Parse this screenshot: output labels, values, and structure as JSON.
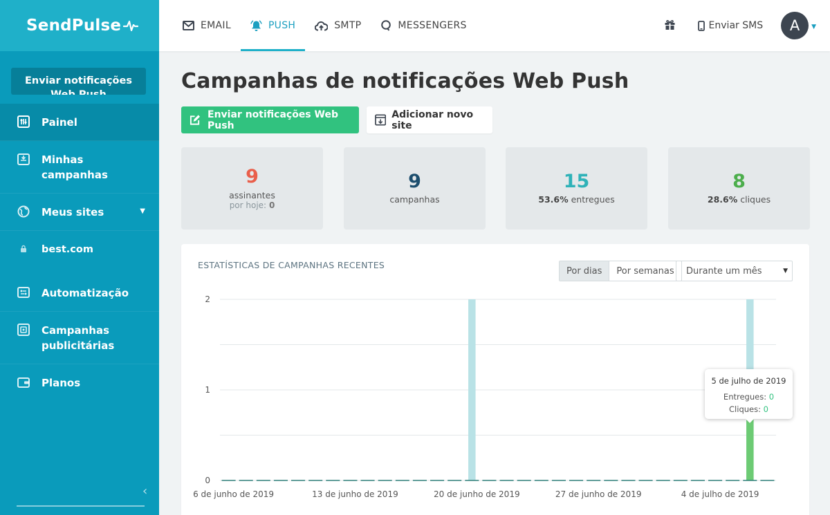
{
  "brand": {
    "name": "SendPulse"
  },
  "sidebar": {
    "send_button": "Enviar notificações Web Push",
    "items": [
      {
        "label": "Painel",
        "icon": "dashboard-icon"
      },
      {
        "label": "Minhas campanhas",
        "icon": "campaigns-icon"
      },
      {
        "label": "Meus sites",
        "icon": "globe-icon"
      },
      {
        "label": "best.com",
        "icon": "lock-icon"
      },
      {
        "label": "Automatização",
        "icon": "automation-icon"
      },
      {
        "label": "Campanhas publicitárias",
        "icon": "ads-icon"
      },
      {
        "label": "Planos",
        "icon": "wallet-icon"
      }
    ]
  },
  "topbar": {
    "tabs": [
      {
        "label": "EMAIL",
        "icon": "mail-icon"
      },
      {
        "label": "PUSH",
        "icon": "bell-icon"
      },
      {
        "label": "SMTP",
        "icon": "cloud-upload-icon"
      },
      {
        "label": "MESSENGERS",
        "icon": "chat-icon"
      }
    ],
    "sms_label": "Enviar SMS",
    "avatar_letter": "A"
  },
  "main": {
    "title": "Campanhas de notificações Web Push",
    "send_button": "Enviar notificações Web Push",
    "add_site_button": "Adicionar novo site"
  },
  "stats": {
    "subscribers": {
      "value": "9",
      "label": "assinantes",
      "today_label": "por hoje:",
      "today_value": "0",
      "color": "#e95e4a"
    },
    "campaigns": {
      "value": "9",
      "label": "campanhas",
      "color": "#1d4e6e"
    },
    "delivered": {
      "value": "15",
      "percent": "53.6%",
      "label": "entregues",
      "color": "#2fb2b8"
    },
    "clicks": {
      "value": "8",
      "percent": "28.6%",
      "label": "cliques",
      "color": "#4cae4c"
    }
  },
  "chart_section": {
    "title": "ESTATÍSTICAS DE CAMPANHAS RECENTES",
    "by_days": "Por dias",
    "by_weeks": "Por semanas",
    "period": "Durante um mês"
  },
  "tooltip": {
    "date": "5 de julho de 2019",
    "delivered_label": "Entregues:",
    "delivered_value": "0",
    "clicks_label": "Cliques:",
    "clicks_value": "0"
  },
  "chart_data": {
    "type": "bar",
    "ylim": [
      0,
      2
    ],
    "yticks": [
      0,
      1,
      2
    ],
    "day_count": 32,
    "xtick_labels": [
      {
        "index": 0,
        "label": "6 de junho de 2019"
      },
      {
        "index": 7,
        "label": "13 de junho de 2019"
      },
      {
        "index": 14,
        "label": "20 de junho de 2019"
      },
      {
        "index": 21,
        "label": "27 de junho de 2019"
      },
      {
        "index": 28,
        "label": "4 de julho de 2019"
      }
    ],
    "series": [
      {
        "color": "#b9e2e6",
        "values": [
          0,
          0,
          0,
          0,
          0,
          0,
          0,
          0,
          0,
          0,
          0,
          0,
          0,
          0,
          2,
          0,
          0,
          0,
          0,
          0,
          0,
          0,
          0,
          0,
          0,
          0,
          0,
          0,
          0,
          0,
          2,
          0
        ]
      },
      {
        "color": "#6dcb74",
        "values": [
          0,
          0,
          0,
          0,
          0,
          0,
          0,
          0,
          0,
          0,
          0,
          0,
          0,
          0,
          0,
          0,
          0,
          0,
          0,
          0,
          0,
          0,
          0,
          0,
          0,
          0,
          0,
          0,
          0,
          0,
          0.7,
          0
        ]
      }
    ],
    "baseline_color": "#2f7f78"
  }
}
